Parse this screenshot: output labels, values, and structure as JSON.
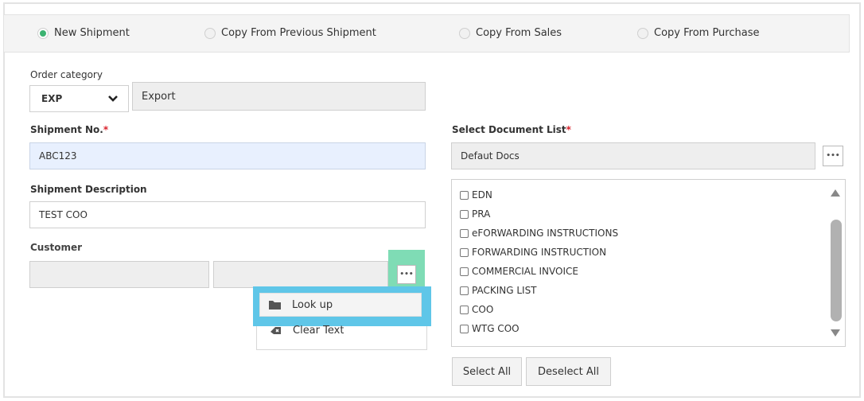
{
  "radios": [
    {
      "label": "New Shipment",
      "selected": true
    },
    {
      "label": "Copy From Previous Shipment",
      "selected": false
    },
    {
      "label": "Copy From Sales",
      "selected": false
    },
    {
      "label": "Copy From Purchase",
      "selected": false
    }
  ],
  "order_category": {
    "label": "Order category",
    "select_value": "EXP",
    "description": "Export"
  },
  "shipment_no": {
    "label": "Shipment No.",
    "required_mark": "*",
    "value": "ABC123"
  },
  "shipment_description": {
    "label": "Shipment Description",
    "value": "TEST COO"
  },
  "customer": {
    "label": "Customer",
    "field1": "",
    "field2": "",
    "more_button": "•••"
  },
  "context_menu": {
    "items": [
      {
        "label": "Look up",
        "icon": "folder-icon"
      },
      {
        "label": "Clear Text",
        "icon": "eraser-icon"
      }
    ]
  },
  "document_list": {
    "label": "Select Document List",
    "required_mark": "*",
    "value": "Defaut Docs",
    "more_button": "•••",
    "items": [
      "EDN",
      "PRA",
      "eFORWARDING INSTRUCTIONS",
      "FORWARDING INSTRUCTION",
      "COMMERCIAL INVOICE",
      "PACKING LIST",
      "COO",
      "WTG COO"
    ],
    "select_all": "Select All",
    "deselect_all": "Deselect All"
  },
  "colors": {
    "radio_selected": "#3cb371",
    "required": "#d9232d",
    "highlight_green": "#7fdcb5",
    "highlight_blue": "#5fc6e8",
    "input_active": "#e8f0fe"
  }
}
